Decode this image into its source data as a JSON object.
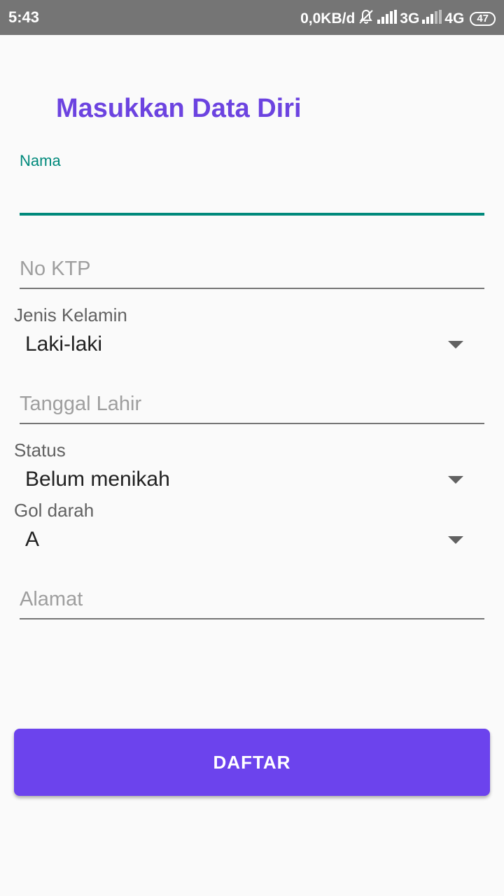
{
  "status_bar": {
    "time": "5:43",
    "network_speed": "0,0KB/d",
    "network1": "3G",
    "network2": "4G",
    "battery": "47"
  },
  "form": {
    "title": "Masukkan Data Diri",
    "nama": {
      "label": "Nama",
      "value": ""
    },
    "no_ktp": {
      "placeholder": "No KTP"
    },
    "jenis_kelamin": {
      "label": "Jenis Kelamin",
      "selected": "Laki-laki"
    },
    "tanggal_lahir": {
      "placeholder": "Tanggal Lahir"
    },
    "status": {
      "label": "Status",
      "selected": "Belum menikah"
    },
    "gol_darah": {
      "label": "Gol darah",
      "selected": "A"
    },
    "alamat": {
      "placeholder": "Alamat"
    },
    "submit_label": "DAFTAR"
  },
  "colors": {
    "accent": "#6c43ed",
    "title": "#6c43e0",
    "focus": "#00897b",
    "status_bar": "#757575"
  }
}
